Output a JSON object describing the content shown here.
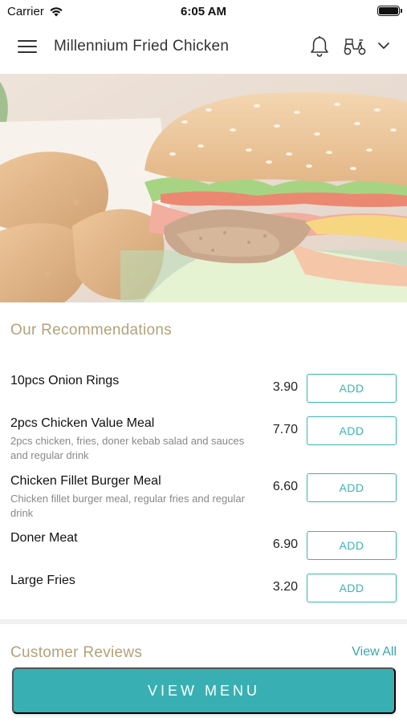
{
  "status_bar": {
    "carrier": "Carrier",
    "time": "6:05 AM"
  },
  "header": {
    "title": "Millennium Fried Chicken",
    "icons": [
      "menu-icon",
      "bell-icon",
      "scooter-icon",
      "chevron-down-icon"
    ]
  },
  "recommendations": {
    "title": "Our Recommendations",
    "add_label": "ADD",
    "items": [
      {
        "name": "10pcs Onion Rings",
        "description": "",
        "price": "3.90"
      },
      {
        "name": "2pcs Chicken Value Meal",
        "description": "2pcs chicken, fries, doner kebab salad and sauces and regular drink",
        "price": "7.70"
      },
      {
        "name": "Chicken Fillet Burger Meal",
        "description": "Chicken fillet burger meal, regular fries and regular drink",
        "price": "6.60"
      },
      {
        "name": "Doner Meat",
        "description": "",
        "price": "6.90"
      },
      {
        "name": "Large Fries",
        "description": "",
        "price": "3.20"
      }
    ]
  },
  "reviews": {
    "title": "Customer Reviews",
    "view_all_label": "View All"
  },
  "footer": {
    "view_menu_label": "VIEW MENU"
  },
  "colors": {
    "accent": "#38b0b3",
    "section_title": "#b3a27a",
    "description": "#888888"
  }
}
